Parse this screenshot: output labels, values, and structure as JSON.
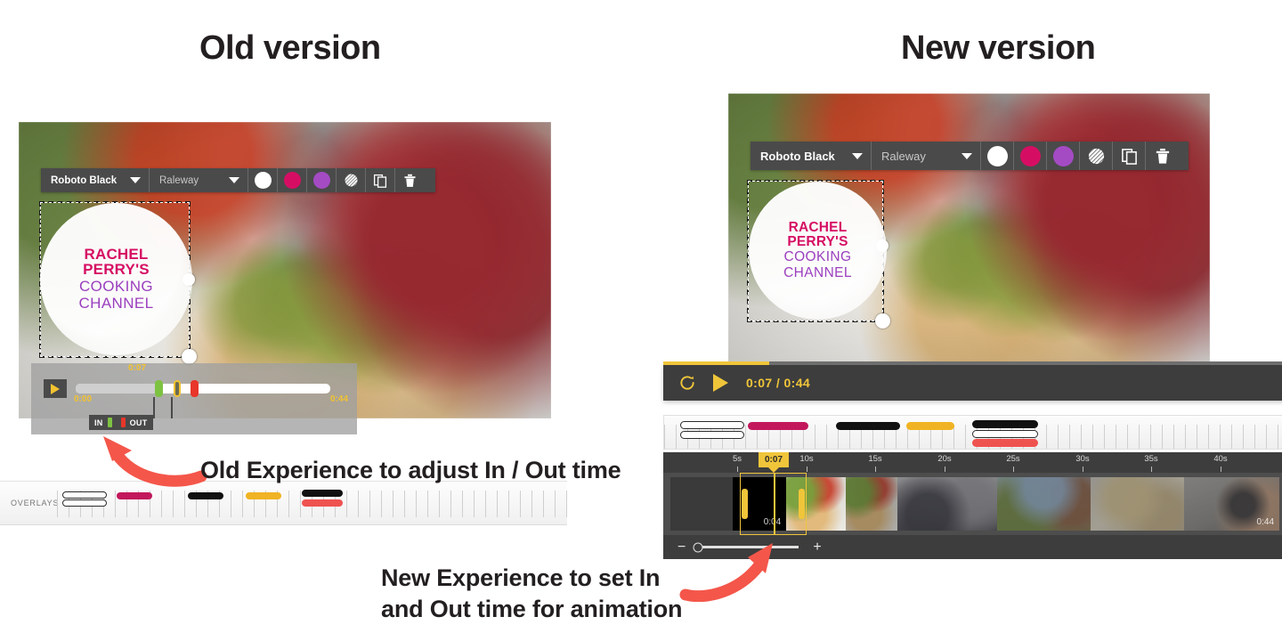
{
  "headings": {
    "old": "Old version",
    "new": "New version"
  },
  "toolbar": {
    "font_primary": "Roboto Black",
    "font_secondary": "Raleway",
    "colors": {
      "white": "#FFFFFF",
      "pink": "#D60E63",
      "purple": "#A44BC4"
    },
    "icons": [
      "opacity-icon",
      "duplicate-icon",
      "trash-icon"
    ]
  },
  "logo_overlay": {
    "line1": "RACHEL",
    "line2": "PERRY'S",
    "line3": "COOKING",
    "line4": "CHANNEL",
    "color_primary": "#D60E63",
    "color_secondary": "#9B3FBE"
  },
  "old_player": {
    "current_time": "0:07",
    "start_time": "0:00",
    "end_time": "0:44",
    "in_label": "IN",
    "out_label": "OUT",
    "in_color": "#7EC242",
    "out_color": "#E8362A",
    "playhead_color": "#F2C230"
  },
  "new_player": {
    "time_display": "0:07 / 0:44",
    "accent": "#F0C53A"
  },
  "old_rail": {
    "label": "OVERLAYS"
  },
  "timeline": {
    "ticks": [
      "5s",
      "10s",
      "15s",
      "20s",
      "25s",
      "30s",
      "35s",
      "40s"
    ],
    "playhead_label": "0:07",
    "clip_time": "0:04",
    "total_time": "0:44"
  },
  "zoom_control": {
    "minus": "−",
    "plus": "+"
  },
  "annotations": {
    "old": "Old Experience to adjust In / Out time",
    "new_line1": "New Experience to set In",
    "new_line2": "and Out time for animation",
    "arrow_color": "#F4564A"
  }
}
